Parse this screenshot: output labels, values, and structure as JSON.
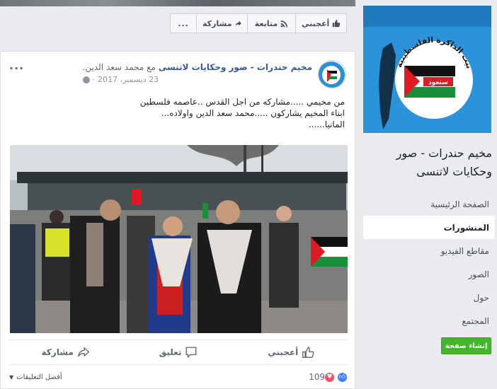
{
  "top_bar": {
    "like_label": "أعجبني",
    "follow_label": "متابعة",
    "share_label": "مشاركة",
    "more_label": "..."
  },
  "post": {
    "page_name": "مخيم حندرات - صور وحكايات لاتنسى",
    "with_text": "مع",
    "tagged_user": "محمد سعد الدين.",
    "date": "23 ديسمبر، 2017",
    "date_separator": "·",
    "more_label": "...",
    "text_lines": [
      "من مخيمي .....مشاركه من اجل القدس ..عاصمه فلسطين",
      "ابناء المخيم يشاركون .....محمد سعد الدين واولاده...",
      "المانيا......"
    ],
    "actions": {
      "like": "أعجبني",
      "comment": "تعليق",
      "share": "مشاركة"
    },
    "reaction_count": "109",
    "sort_label": "أفضل التعليقات"
  },
  "sidebar": {
    "cover_text": "بيت الذاكرة الفلسطينية",
    "cover_flag_text": "سنعود",
    "title": "مخيم حندرات - صور وحكايات لاتنسى",
    "nav": [
      {
        "label": "الصفحة الرئيسية"
      },
      {
        "label": "المنشورات"
      },
      {
        "label": "مقاطع الفيديو"
      },
      {
        "label": "الصور"
      },
      {
        "label": "حول"
      },
      {
        "label": "المجتمع"
      }
    ],
    "create_page": "إنشاء صفحة"
  },
  "colors": {
    "link": "#365899",
    "create_green": "#42b72a",
    "like_blue": "#4080ff",
    "love_red": "#f25268"
  }
}
